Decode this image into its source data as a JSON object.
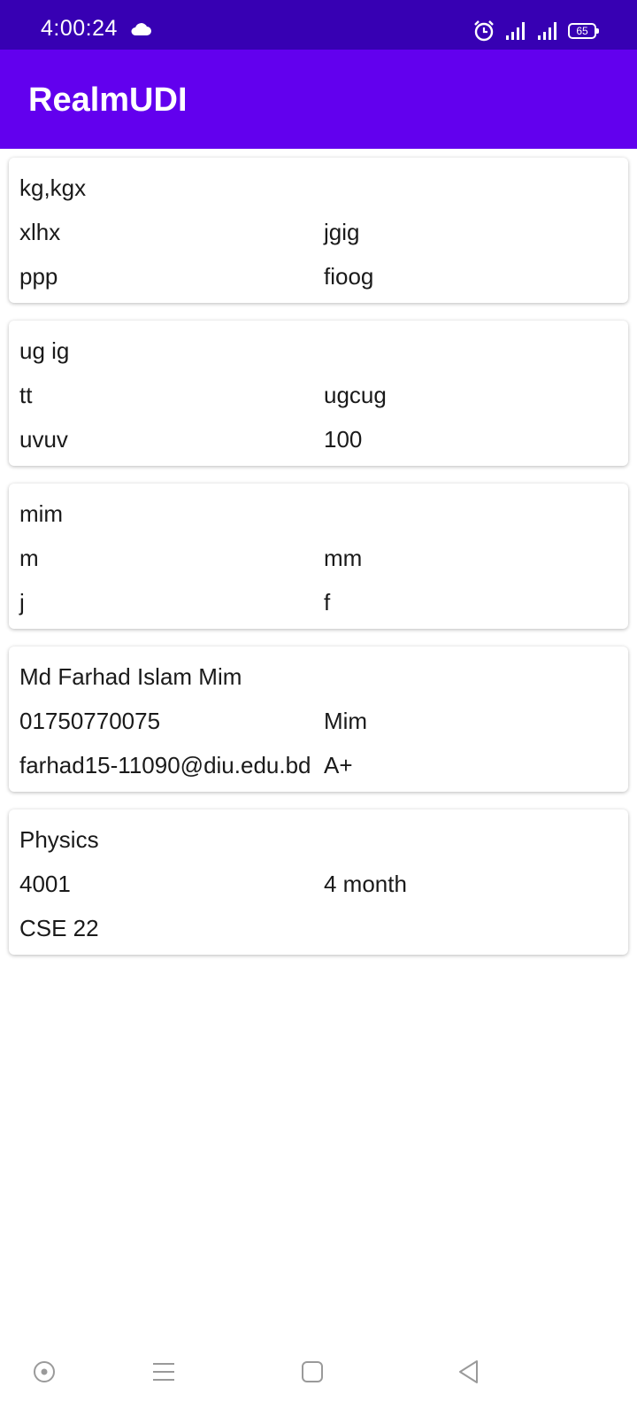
{
  "status_bar": {
    "time": "4:00:24",
    "battery": "65",
    "icons": [
      "cloud-icon",
      "alarm-icon",
      "signal-icon",
      "signal-icon",
      "battery-icon"
    ]
  },
  "app_bar": {
    "title": "RealmUDI",
    "color": "#6200ee",
    "status_color": "#3700b3"
  },
  "cards": [
    {
      "title": "kg,kgx",
      "r1_left": "xlhx",
      "r1_right": "jgig",
      "r2_left": "ppp",
      "r2_right": "fioog"
    },
    {
      "title": "ug ig",
      "r1_left": "tt",
      "r1_right": "ugcug",
      "r2_left": "uvuv",
      "r2_right": "100"
    },
    {
      "title": "mim",
      "r1_left": "m",
      "r1_right": "mm",
      "r2_left": "j",
      "r2_right": "f"
    },
    {
      "title": "Md Farhad Islam Mim",
      "r1_left": "01750770075",
      "r1_right": "Mim",
      "r2_left": "farhad15-11090@diu.edu.bd",
      "r2_right": "A+"
    },
    {
      "title": "Physics",
      "r1_left": "4001",
      "r1_right": "4 month",
      "r2_left": "CSE 22",
      "r2_right": ""
    }
  ],
  "nav_bar": {
    "icons": [
      "assistant-icon",
      "menu-icon",
      "home-square-icon",
      "back-triangle-icon"
    ]
  }
}
